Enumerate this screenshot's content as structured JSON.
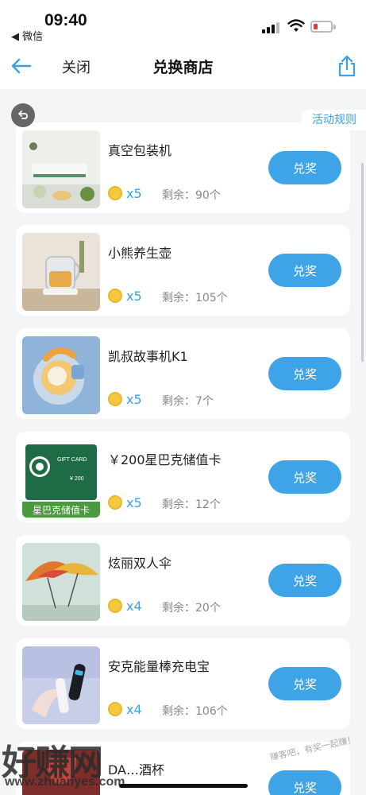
{
  "status_bar": {
    "time": "09:40",
    "back_app": "◀ 微信",
    "battery_color": "#e53935"
  },
  "nav": {
    "close_label": "关闭",
    "title": "兑换商店",
    "back_icon": "arrow-left-icon",
    "share_icon": "share-icon"
  },
  "rules_label": "活动规则",
  "accent_color": "#3fa3e8",
  "items": [
    {
      "name": "真空包装机",
      "cost": "x5",
      "stock_label": "剩余：",
      "stock": "90个",
      "button": "兑奖"
    },
    {
      "name": "小熊养生壶",
      "cost": "x5",
      "stock_label": "剩余：",
      "stock": "105个",
      "button": "兑奖"
    },
    {
      "name": "凯叔故事机K1",
      "cost": "x5",
      "stock_label": "剩余：",
      "stock": "7个",
      "button": "兑奖"
    },
    {
      "name": "￥200星巴克储值卡",
      "cost": "x5",
      "stock_label": "剩余：",
      "stock": "12个",
      "button": "兑奖",
      "thumb_caption": "星巴克储值卡",
      "thumb_card_title": "GIFT CARD",
      "thumb_card_value": "¥ 200"
    },
    {
      "name": "炫丽双人伞",
      "cost": "x4",
      "stock_label": "剩余：",
      "stock": "20个",
      "button": "兑奖"
    },
    {
      "name": "安克能量棒充电宝",
      "cost": "x4",
      "stock_label": "剩余：",
      "stock": "106个",
      "button": "兑奖"
    },
    {
      "name": "DA…酒杯",
      "button": "兑奖"
    }
  ],
  "watermark": {
    "main": "好赚网",
    "url": "www.zhuanyes.com",
    "slogan": "赚客吧，有奖一起赚！"
  }
}
